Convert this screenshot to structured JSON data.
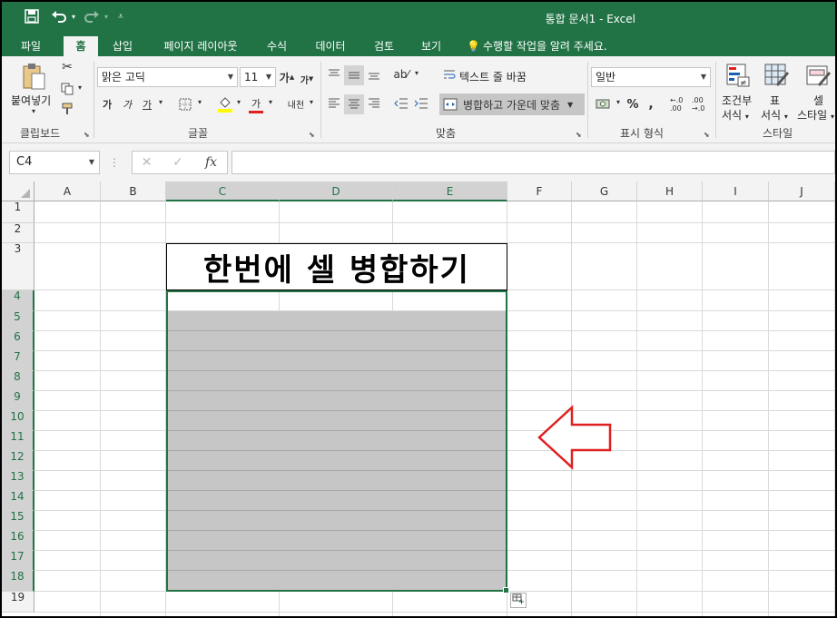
{
  "app": {
    "window_title": "통합 문서1 - Excel"
  },
  "qat": {
    "save_icon": "save-icon",
    "undo_icon": "undo-icon",
    "redo_icon": "redo-icon",
    "customize_icon": "customize-qat-icon"
  },
  "tabs": [
    {
      "label": "파일"
    },
    {
      "label": "홈"
    },
    {
      "label": "삽입"
    },
    {
      "label": "페이지 레이아웃"
    },
    {
      "label": "수식"
    },
    {
      "label": "데이터"
    },
    {
      "label": "검토"
    },
    {
      "label": "보기"
    },
    {
      "label": "수행할 작업을 알려 주세요."
    }
  ],
  "ribbon": {
    "clipboard": {
      "paste_label": "붙여넣기",
      "group_label": "클립보드"
    },
    "font": {
      "font_name": "맑은 고딕",
      "font_size": "11",
      "group_label": "글꼴",
      "grow": "가",
      "shrink": "가",
      "bold": "가",
      "italic": "가",
      "underline": "가",
      "font_color": "가",
      "phonetic": "내천"
    },
    "alignment": {
      "wrap_text": "텍스트 줄 바꿈",
      "merge_center": "병합하고 가운데 맞춤",
      "group_label": "맞춤"
    },
    "number": {
      "format": "일반",
      "percent": "%",
      "comma": ",",
      "inc_decimal": "←.0 .00",
      "dec_decimal": ".00 →.0",
      "group_label": "표시 형식"
    },
    "styles": {
      "conditional_1": "조건부",
      "conditional_2": "서식",
      "table_1": "표",
      "table_2": "서식",
      "cell_1": "셀",
      "cell_2": "스타일",
      "group_label": "스타일"
    }
  },
  "formula_bar": {
    "name_box": "C4",
    "cancel": "✕",
    "enter": "✓",
    "fx": "fx",
    "value": ""
  },
  "sheet": {
    "columns": [
      "A",
      "B",
      "C",
      "D",
      "E",
      "F",
      "G",
      "H",
      "I",
      "J"
    ],
    "rows": [
      "1",
      "2",
      "3",
      "4",
      "5",
      "6",
      "7",
      "8",
      "9",
      "10",
      "11",
      "12",
      "13",
      "14",
      "15",
      "16",
      "17",
      "18",
      "19"
    ],
    "selected_columns": [
      "C",
      "D",
      "E"
    ],
    "selected_rows": [
      "4",
      "5",
      "6",
      "7",
      "8",
      "9",
      "10",
      "11",
      "12",
      "13",
      "14",
      "15",
      "16",
      "17",
      "18"
    ],
    "merged_title": "한번에 셀 병합하기",
    "fill_color": "#c6c6c6",
    "arrow_color": "#e02020"
  },
  "colors": {
    "accent": "#217346"
  }
}
